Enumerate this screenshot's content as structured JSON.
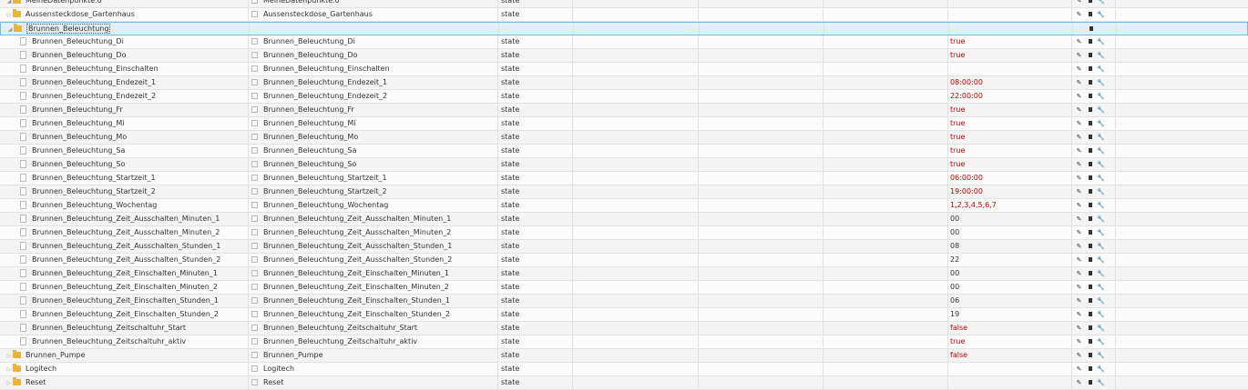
{
  "type_label": "state",
  "icons": {
    "edit": "pencil-icon",
    "delete": "trash-icon",
    "settings": "wrench-icon"
  },
  "rows": [
    {
      "level": 0,
      "folder": true,
      "expanded": true,
      "name": "MeineDatenpunkte.0",
      "title": "MeineDatenpunkte.0",
      "type": "state",
      "value": ""
    },
    {
      "level": 1,
      "folder": true,
      "expanded": false,
      "name": "Aussensteckdose_Gartenhaus",
      "title": "Aussensteckdose_Gartenhaus",
      "type": "state",
      "value": ""
    },
    {
      "level": 1,
      "folder": true,
      "expanded": true,
      "selected": true,
      "name": "Brunnen_Beleuchtung",
      "title": "",
      "type": "",
      "value": ""
    },
    {
      "level": 2,
      "name": "Brunnen_Beleuchtung_Di",
      "title": "Brunnen_Beleuchtung_Di",
      "type": "state",
      "value": "true",
      "colored": true
    },
    {
      "level": 2,
      "name": "Brunnen_Beleuchtung_Do",
      "title": "Brunnen_Beleuchtung_Do",
      "type": "state",
      "value": "true",
      "colored": true
    },
    {
      "level": 2,
      "name": "Brunnen_Beleuchtung_Einschalten",
      "title": "Brunnen_Beleuchtung_Einschalten",
      "type": "state",
      "value": ""
    },
    {
      "level": 2,
      "name": "Brunnen_Beleuchtung_Endezeit_1",
      "title": "Brunnen_Beleuchtung_Endezeit_1",
      "type": "state",
      "value": "08:00:00",
      "colored": true
    },
    {
      "level": 2,
      "name": "Brunnen_Beleuchtung_Endezeit_2",
      "title": "Brunnen_Beleuchtung_Endezeit_2",
      "type": "state",
      "value": "22:00:00",
      "colored": true
    },
    {
      "level": 2,
      "name": "Brunnen_Beleuchtung_Fr",
      "title": "Brunnen_Beleuchtung_Fr",
      "type": "state",
      "value": "true",
      "colored": true
    },
    {
      "level": 2,
      "name": "Brunnen_Beleuchtung_Mi",
      "title": "Brunnen_Beleuchtung_Mi",
      "type": "state",
      "value": "true",
      "colored": true
    },
    {
      "level": 2,
      "name": "Brunnen_Beleuchtung_Mo",
      "title": "Brunnen_Beleuchtung_Mo",
      "type": "state",
      "value": "true",
      "colored": true
    },
    {
      "level": 2,
      "name": "Brunnen_Beleuchtung_Sa",
      "title": "Brunnen_Beleuchtung_Sa",
      "type": "state",
      "value": "true",
      "colored": true
    },
    {
      "level": 2,
      "name": "Brunnen_Beleuchtung_So",
      "title": "Brunnen_Beleuchtung_So",
      "type": "state",
      "value": "true",
      "colored": true
    },
    {
      "level": 2,
      "name": "Brunnen_Beleuchtung_Startzeit_1",
      "title": "Brunnen_Beleuchtung_Startzeit_1",
      "type": "state",
      "value": "06:00:00",
      "colored": true
    },
    {
      "level": 2,
      "name": "Brunnen_Beleuchtung_Startzeit_2",
      "title": "Brunnen_Beleuchtung_Startzeit_2",
      "type": "state",
      "value": "19:00:00",
      "colored": true
    },
    {
      "level": 2,
      "name": "Brunnen_Beleuchtung_Wochentag",
      "title": "Brunnen_Beleuchtung_Wochentag",
      "type": "state",
      "value": "1,2,3,4,5,6,7",
      "colored": true
    },
    {
      "level": 2,
      "name": "Brunnen_Beleuchtung_Zeit_Ausschalten_Minuten_1",
      "title": "Brunnen_Beleuchtung_Zeit_Ausschalten_Minuten_1",
      "type": "state",
      "value": "00"
    },
    {
      "level": 2,
      "name": "Brunnen_Beleuchtung_Zeit_Ausschalten_Minuten_2",
      "title": "Brunnen_Beleuchtung_Zeit_Ausschalten_Minuten_2",
      "type": "state",
      "value": "00"
    },
    {
      "level": 2,
      "name": "Brunnen_Beleuchtung_Zeit_Ausschalten_Stunden_1",
      "title": "Brunnen_Beleuchtung_Zeit_Ausschalten_Stunden_1",
      "type": "state",
      "value": "08"
    },
    {
      "level": 2,
      "name": "Brunnen_Beleuchtung_Zeit_Ausschalten_Stunden_2",
      "title": "Brunnen_Beleuchtung_Zeit_Ausschalten_Stunden_2",
      "type": "state",
      "value": "22"
    },
    {
      "level": 2,
      "name": "Brunnen_Beleuchtung_Zeit_Einschalten_Minuten_1",
      "title": "Brunnen_Beleuchtung_Zeit_Einschalten_Minuten_1",
      "type": "state",
      "value": "00"
    },
    {
      "level": 2,
      "name": "Brunnen_Beleuchtung_Zeit_Einschalten_Minuten_2",
      "title": "Brunnen_Beleuchtung_Zeit_Einschalten_Minuten_2",
      "type": "state",
      "value": "00"
    },
    {
      "level": 2,
      "name": "Brunnen_Beleuchtung_Zeit_Einschalten_Stunden_1",
      "title": "Brunnen_Beleuchtung_Zeit_Einschalten_Stunden_1",
      "type": "state",
      "value": "06"
    },
    {
      "level": 2,
      "name": "Brunnen_Beleuchtung_Zeit_Einschalten_Stunden_2",
      "title": "Brunnen_Beleuchtung_Zeit_Einschalten_Stunden_2",
      "type": "state",
      "value": "19"
    },
    {
      "level": 2,
      "name": "Brunnen_Beleuchtung_Zeitschaltuhr_Start",
      "title": "Brunnen_Beleuchtung_Zeitschaltuhr_Start",
      "type": "state",
      "value": "false",
      "colored": true
    },
    {
      "level": 2,
      "name": "Brunnen_Beleuchtung_Zeitschaltuhr_aktiv",
      "title": "Brunnen_Beleuchtung_Zeitschaltuhr_aktiv",
      "type": "state",
      "value": "true",
      "colored": true
    },
    {
      "level": 1,
      "folder": true,
      "expanded": false,
      "name": "Brunnen_Pumpe",
      "title": "Brunnen_Pumpe",
      "type": "state",
      "value": "false",
      "colored": true
    },
    {
      "level": 1,
      "folder": true,
      "expanded": false,
      "name": "Logitech",
      "title": "Logitech",
      "type": "state",
      "value": ""
    },
    {
      "level": 1,
      "folder": true,
      "expanded": false,
      "name": "Reset",
      "title": "Reset",
      "type": "state",
      "value": ""
    }
  ]
}
